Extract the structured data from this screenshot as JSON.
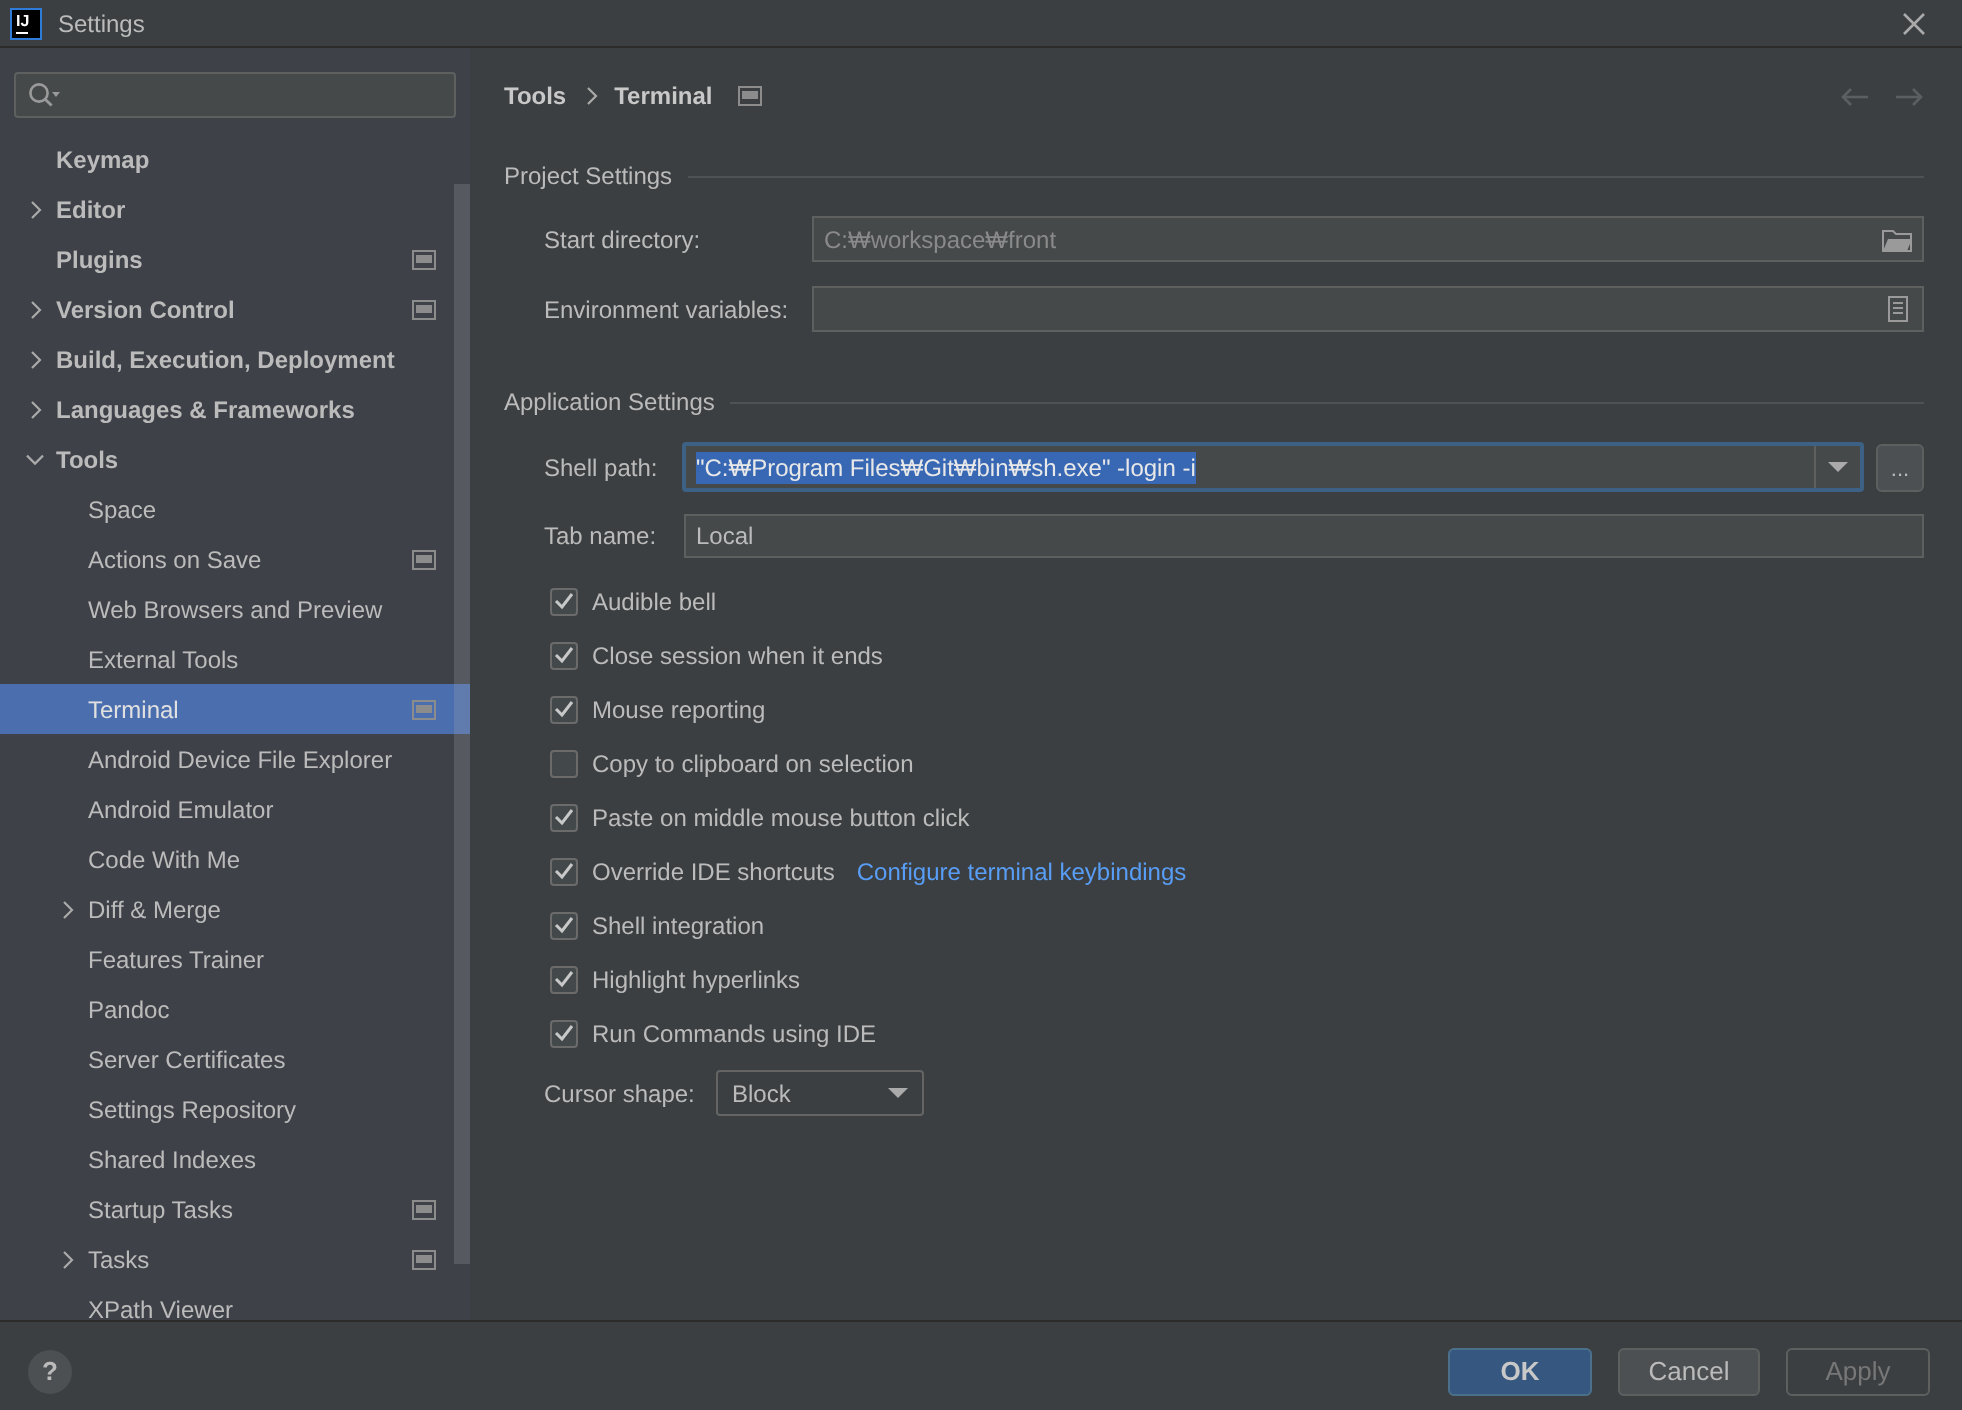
{
  "window": {
    "icon_text": "IJ",
    "title": "Settings"
  },
  "sidebar": {
    "items": [
      {
        "label": "Keymap",
        "selected": false,
        "project_level": false
      },
      {
        "label": "Editor",
        "expanded": false,
        "selected": false,
        "project_level": false
      },
      {
        "label": "Plugins",
        "selected": false,
        "project_level": true
      },
      {
        "label": "Version Control",
        "expanded": false,
        "selected": false,
        "project_level": true
      },
      {
        "label": "Build, Execution, Deployment",
        "expanded": false,
        "selected": false,
        "project_level": false
      },
      {
        "label": "Languages & Frameworks",
        "expanded": false,
        "selected": false,
        "project_level": false
      },
      {
        "label": "Tools",
        "expanded": true,
        "selected": false,
        "project_level": false,
        "children": [
          {
            "label": "Space",
            "selected": false,
            "project_level": false
          },
          {
            "label": "Actions on Save",
            "selected": false,
            "project_level": true
          },
          {
            "label": "Web Browsers and Preview",
            "selected": false,
            "project_level": false
          },
          {
            "label": "External Tools",
            "selected": false,
            "project_level": false
          },
          {
            "label": "Terminal",
            "selected": true,
            "project_level": true
          },
          {
            "label": "Android Device File Explorer",
            "selected": false,
            "project_level": false
          },
          {
            "label": "Android Emulator",
            "selected": false,
            "project_level": false
          },
          {
            "label": "Code With Me",
            "selected": false,
            "project_level": false
          },
          {
            "label": "Diff & Merge",
            "expanded": false,
            "selected": false,
            "project_level": false
          },
          {
            "label": "Features Trainer",
            "selected": false,
            "project_level": false
          },
          {
            "label": "Pandoc",
            "selected": false,
            "project_level": false
          },
          {
            "label": "Server Certificates",
            "selected": false,
            "project_level": false
          },
          {
            "label": "Settings Repository",
            "selected": false,
            "project_level": false
          },
          {
            "label": "Shared Indexes",
            "selected": false,
            "project_level": false
          },
          {
            "label": "Startup Tasks",
            "selected": false,
            "project_level": true
          },
          {
            "label": "Tasks",
            "expanded": false,
            "selected": false,
            "project_level": true
          },
          {
            "label": "XPath Viewer",
            "selected": false,
            "project_level": false
          }
        ]
      }
    ]
  },
  "header": {
    "breadcrumb": [
      "Tools",
      "Terminal"
    ],
    "project_level": true,
    "back_disabled": true,
    "forward_disabled": true
  },
  "project_settings": {
    "title": "Project Settings",
    "fields": [
      {
        "kind": "directory",
        "label": "Start directory:",
        "placeholder": "C:₩workspace₩front"
      },
      {
        "kind": "environment",
        "label": "Environment variables:"
      }
    ]
  },
  "application_settings": {
    "title": "Application Settings",
    "shell_path": {
      "label": "Shell path:",
      "value": "\"C:₩Program Files₩Git₩bin₩sh.exe\" -login -i",
      "focused": true,
      "browse_label": "..."
    },
    "tab_name": {
      "label": "Tab name:",
      "value": "Local"
    },
    "options": [
      {
        "label": "Audible bell",
        "checked": true
      },
      {
        "label": "Close session when it ends",
        "checked": true
      },
      {
        "label": "Mouse reporting",
        "checked": true
      },
      {
        "label": "Copy to clipboard on selection",
        "checked": false
      },
      {
        "label": "Paste on middle mouse button click",
        "checked": true
      },
      {
        "label": "Override IDE shortcuts",
        "checked": true,
        "link": "Configure terminal keybindings"
      },
      {
        "label": "Shell integration",
        "checked": true
      },
      {
        "label": "Highlight hyperlinks",
        "checked": true
      },
      {
        "label": "Run Commands using IDE",
        "checked": true
      }
    ],
    "cursor_shape": {
      "label": "Cursor shape:",
      "value": "Block"
    }
  },
  "footer": {
    "help": "?",
    "buttons": [
      {
        "label": "OK",
        "kind": "primary",
        "disabled": false
      },
      {
        "label": "Cancel",
        "kind": "secondary",
        "disabled": false
      },
      {
        "label": "Apply",
        "kind": "secondary",
        "disabled": true
      }
    ]
  }
}
